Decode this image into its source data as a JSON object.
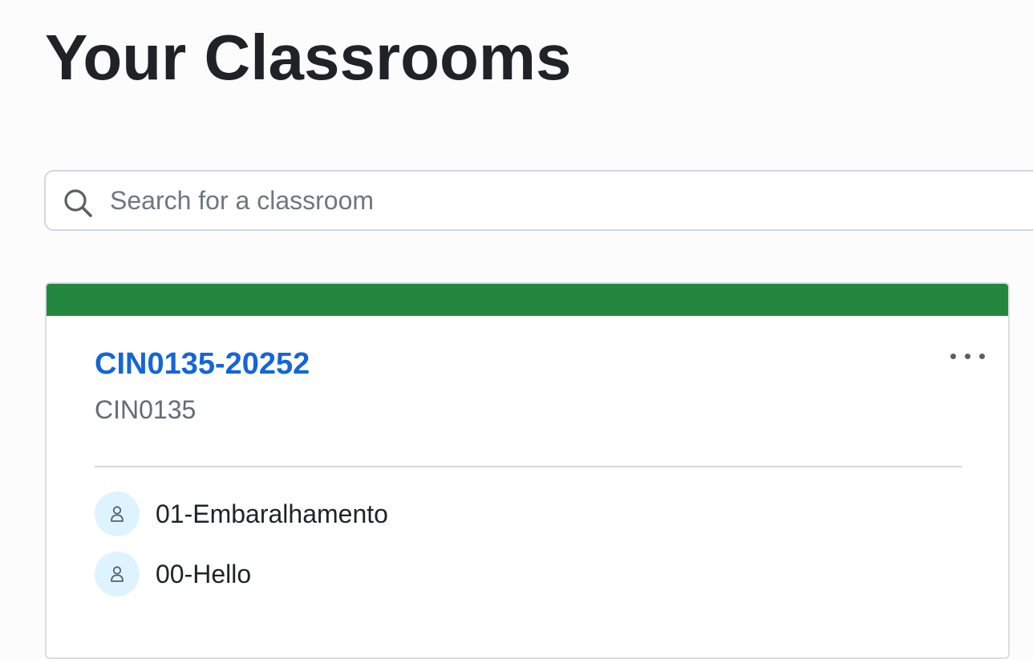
{
  "page": {
    "title": "Your Classrooms"
  },
  "search": {
    "placeholder": "Search for a classroom",
    "value": ""
  },
  "classroom": {
    "name": "CIN0135-20252",
    "organization": "CIN0135",
    "header_color": "#238740",
    "title_color": "#1565d8",
    "assignments": [
      {
        "label": "01-Embaralhamento",
        "icon": "person-icon"
      },
      {
        "label": "00-Hello",
        "icon": "person-icon"
      }
    ],
    "menu_icon": "kebab-horizontal-icon"
  }
}
